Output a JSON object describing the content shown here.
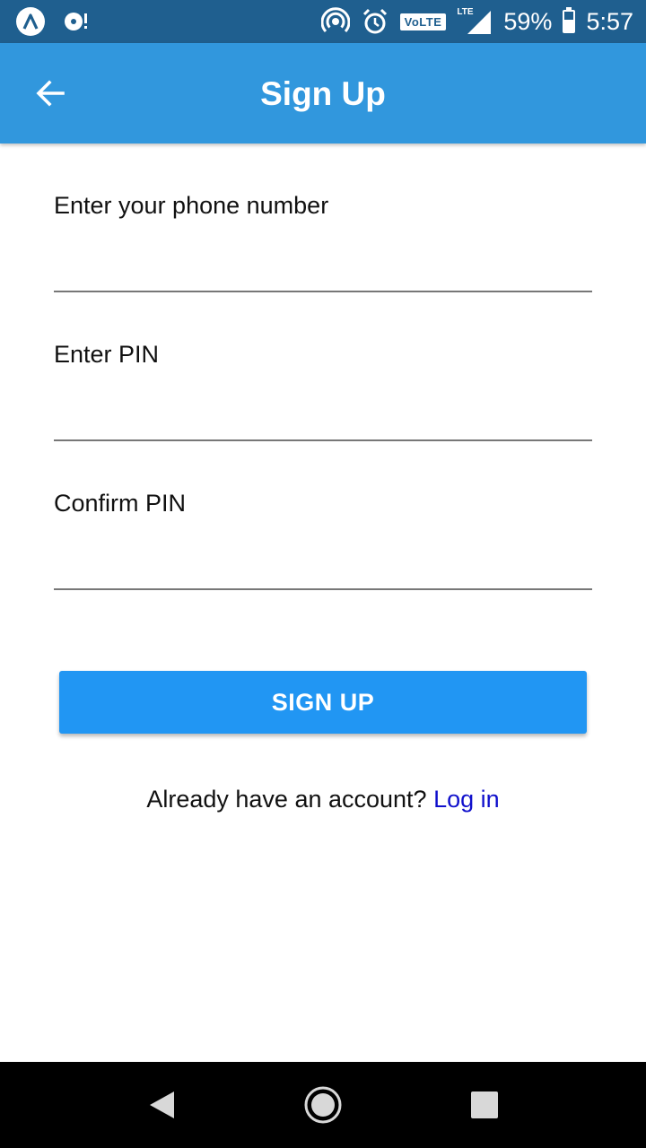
{
  "status_bar": {
    "icons_left": [
      "app-notification-icon",
      "disc-notification-icon"
    ],
    "icons_right": [
      "hotspot-icon",
      "alarm-icon",
      "volte-badge",
      "lte-signal-icon",
      "battery-icon"
    ],
    "volte_label": "VoLTE",
    "lte_label": "LTE",
    "battery_percent": "59%",
    "battery_level": 0.59,
    "time": "5:57"
  },
  "app_bar": {
    "back_icon": "arrow-back-icon",
    "title": "Sign Up",
    "color": "#3197dd"
  },
  "form": {
    "phone": {
      "label": "Enter your phone number",
      "value": ""
    },
    "pin": {
      "label": "Enter PIN",
      "value": ""
    },
    "confirm_pin": {
      "label": "Confirm PIN",
      "value": ""
    },
    "submit_label": "SIGN UP",
    "submit_color": "#2196f3"
  },
  "login": {
    "prompt": "Already have an account?",
    "link_label": "Log in",
    "link_color": "#1010cc"
  },
  "nav_bar": {
    "buttons": [
      "back-triangle-icon",
      "home-circle-icon",
      "recents-square-icon"
    ]
  }
}
